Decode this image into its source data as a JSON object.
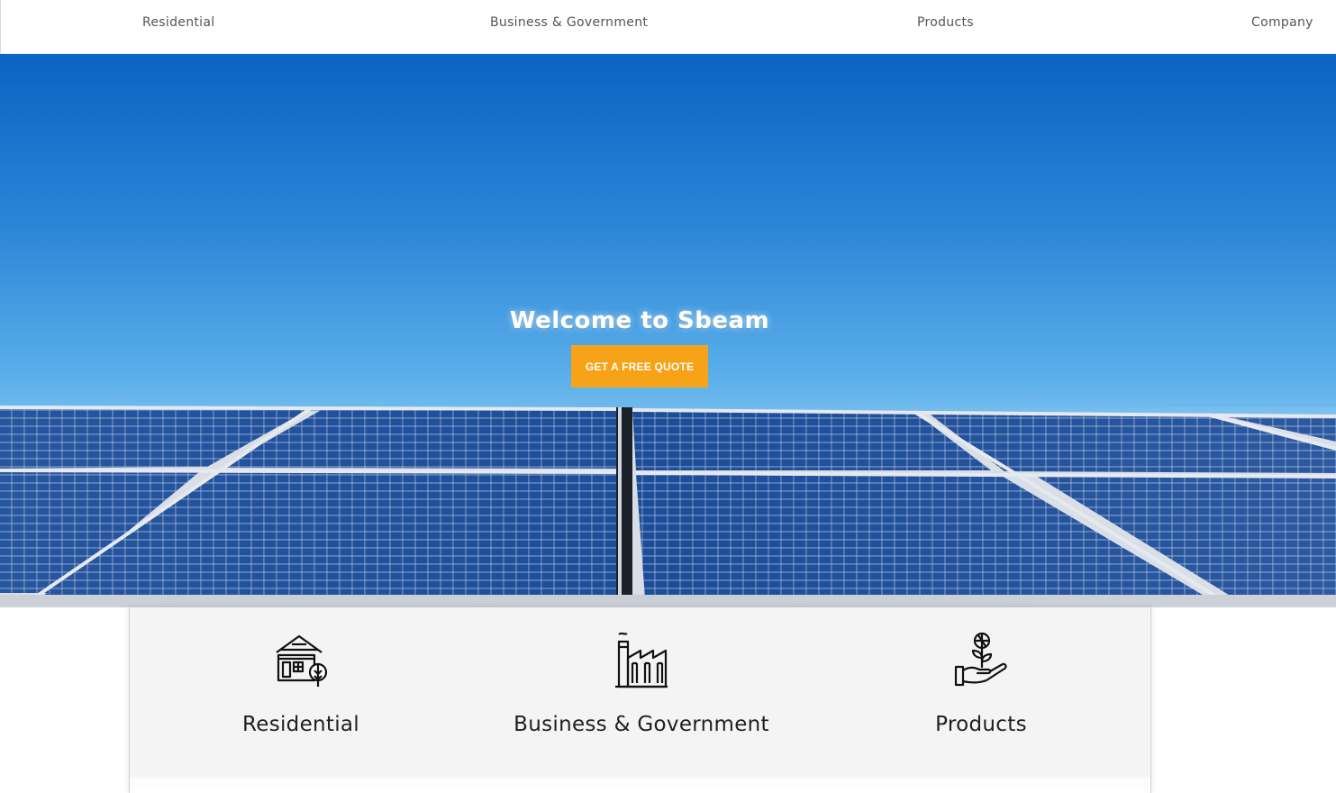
{
  "nav": {
    "items": [
      {
        "label": "Residential"
      },
      {
        "label": "Business & Government"
      },
      {
        "label": "Products"
      },
      {
        "label": "Company"
      }
    ]
  },
  "hero": {
    "title": "Welcome to Sbeam",
    "cta_label": "GET A FREE QUOTE"
  },
  "services": [
    {
      "label": "Residential",
      "icon": "house-tree-icon"
    },
    {
      "label": "Business & Government",
      "icon": "factory-icon"
    },
    {
      "label": "Products",
      "icon": "hand-plant-icon"
    }
  ],
  "colors": {
    "accent": "#f7a318",
    "sky_top": "#0b63c2",
    "sky_bottom": "#8fcaf2",
    "panel": "#123f8a",
    "text_dark": "#1f1f1f",
    "nav_text": "#555555"
  }
}
